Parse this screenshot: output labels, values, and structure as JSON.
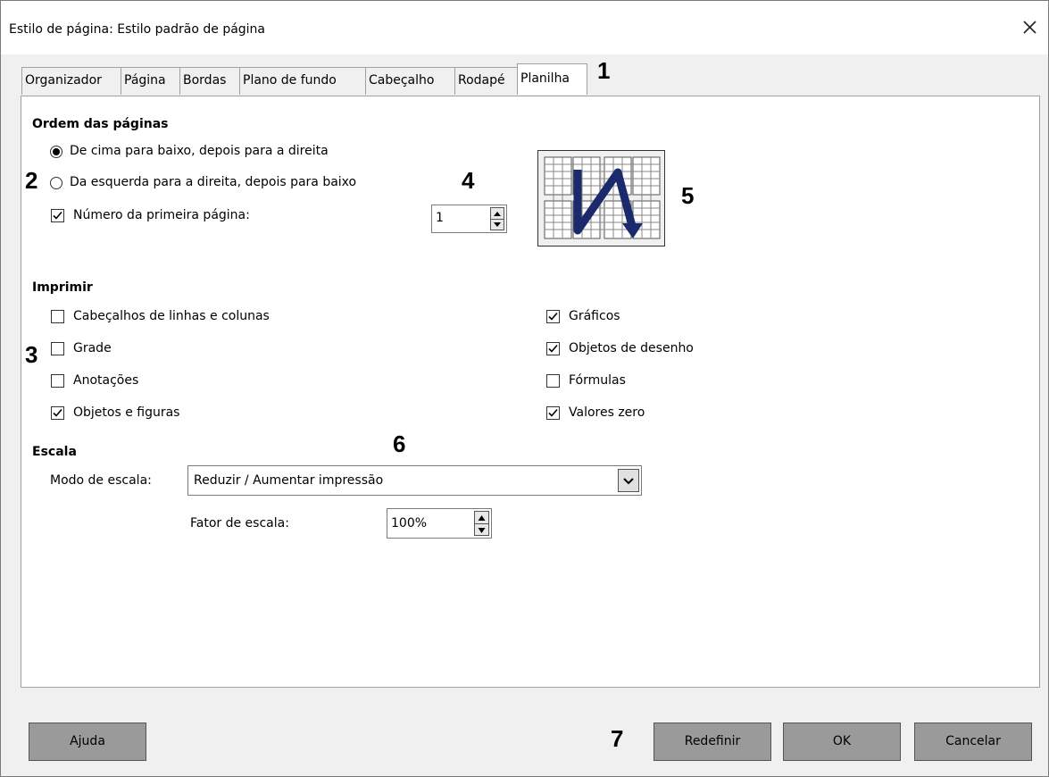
{
  "window": {
    "title": "Estilo de página: Estilo padrão de página"
  },
  "tabs": [
    {
      "label": "Organizador",
      "active": false
    },
    {
      "label": "Página",
      "active": false
    },
    {
      "label": "Bordas",
      "active": false
    },
    {
      "label": "Plano de fundo",
      "active": false
    },
    {
      "label": "Cabeçalho",
      "active": false
    },
    {
      "label": "Rodapé",
      "active": false
    },
    {
      "label": "Planilha",
      "active": true
    }
  ],
  "page_order": {
    "title": "Ordem das páginas",
    "option_top_down": {
      "label": "De cima para baixo, depois para a direita",
      "selected": true
    },
    "option_left_right": {
      "label": "Da esquerda para a direita, depois para baixo",
      "selected": false
    },
    "first_page_number": {
      "label": "Número da primeira página:",
      "checked": true,
      "value": "1"
    }
  },
  "print": {
    "title": "Imprimir",
    "left_options": [
      {
        "label": "Cabeçalhos de linhas e colunas",
        "checked": false
      },
      {
        "label": "Grade",
        "checked": false
      },
      {
        "label": "Anotações",
        "checked": false
      },
      {
        "label": "Objetos e figuras",
        "checked": true
      }
    ],
    "right_options": [
      {
        "label": "Gráficos",
        "checked": true
      },
      {
        "label": "Objetos de desenho",
        "checked": true
      },
      {
        "label": "Fórmulas",
        "checked": false
      },
      {
        "label": "Valores zero",
        "checked": true
      }
    ]
  },
  "scale": {
    "title": "Escala",
    "mode_label": "Modo de escala:",
    "mode_value": "Reduzir / Aumentar impressão",
    "factor_label": "Fator de escala:",
    "factor_value": "100%"
  },
  "buttons": {
    "help": "Ajuda",
    "reset": "Redefinir",
    "ok": "OK",
    "cancel": "Cancelar"
  },
  "annotations": [
    "1",
    "2",
    "3",
    "4",
    "5",
    "6",
    "7"
  ],
  "icons": {
    "close": "close-icon",
    "checkmark": "checkmark-icon",
    "spin": "spin-arrows-icon",
    "dropdown": "chevron-down-icon",
    "preview": "page-order-preview-icon"
  },
  "colors": {
    "preview_arrow": "#1a2a6c",
    "button_bg": "#9a9a9a"
  }
}
